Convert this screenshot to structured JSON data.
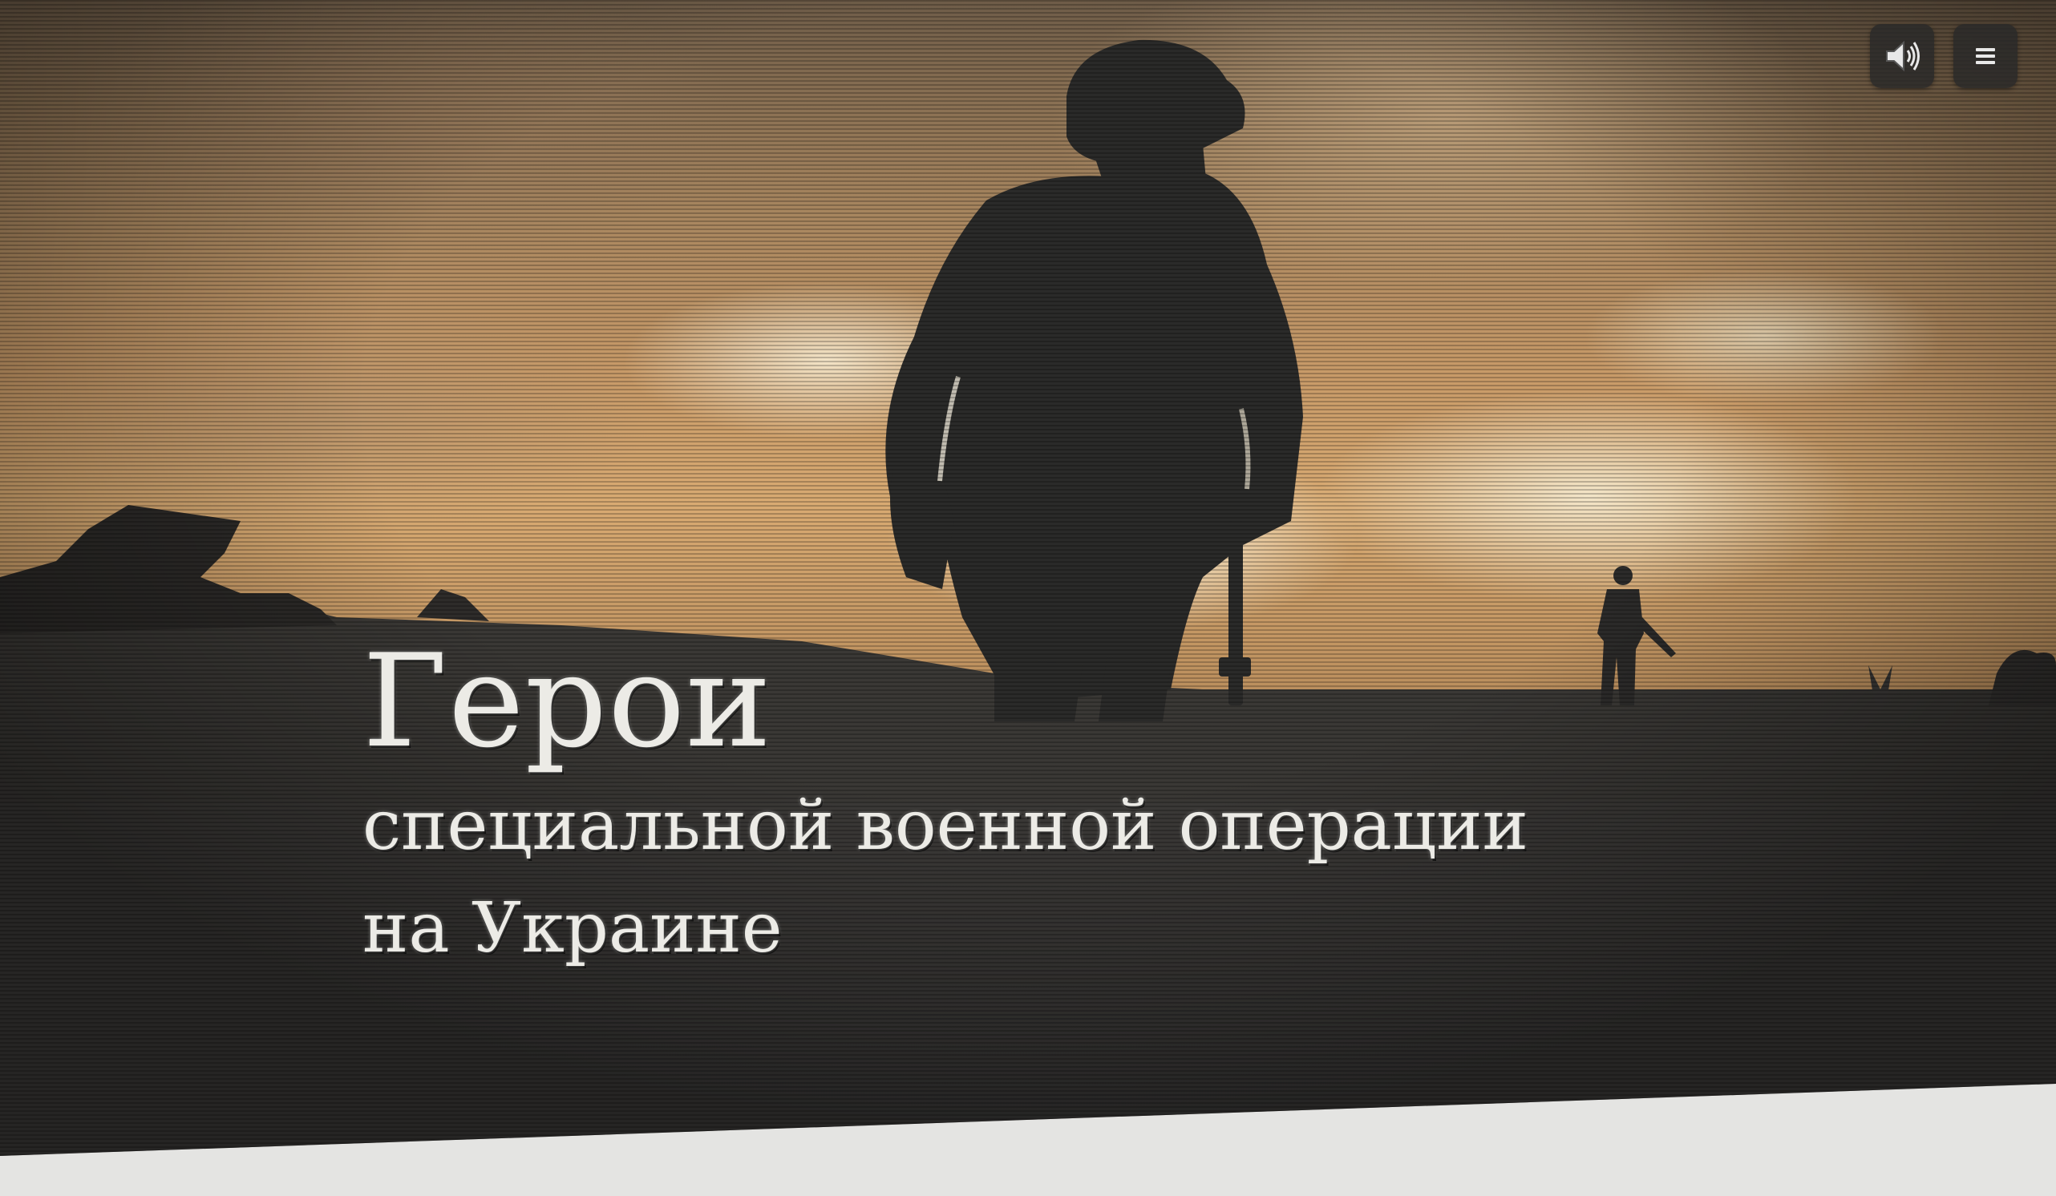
{
  "hero": {
    "title": "Герои",
    "subtitle_line1": "специальной военной операции",
    "subtitle_line2": "на Украине"
  },
  "controls": {
    "sound_icon": "speaker-icon",
    "menu_icon": "hamburger-menu-icon"
  },
  "colors": {
    "title_text": "#ecebe6",
    "ground": "#3a3835",
    "sky_warm": "#c89a68",
    "button_bg": "#282828",
    "bottom_band": "#e4e4e2"
  }
}
